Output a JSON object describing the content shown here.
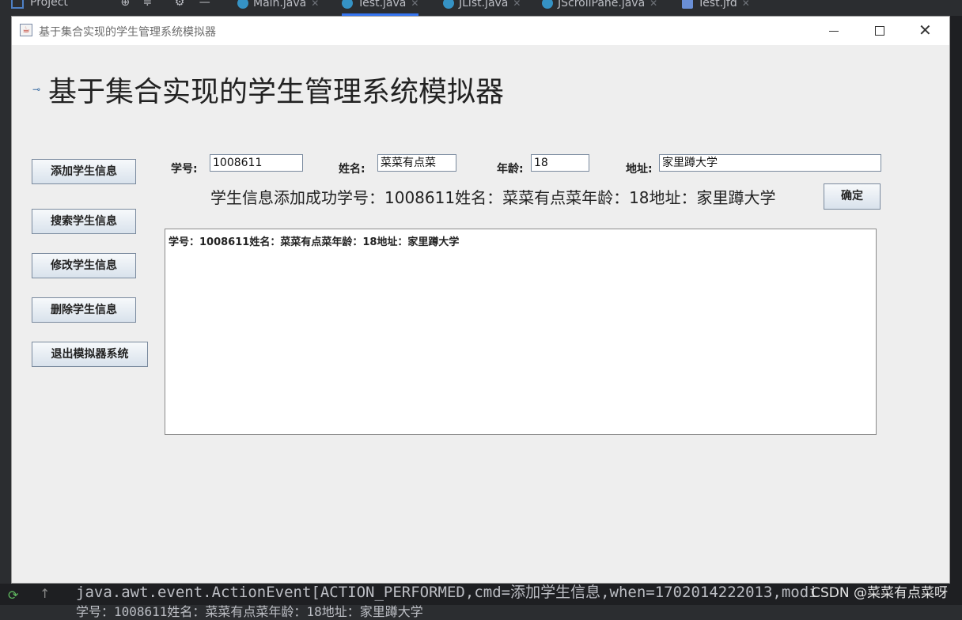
{
  "ide": {
    "project_label": "Project",
    "tabs": [
      {
        "label": "Main.java"
      },
      {
        "label": "Test.java"
      },
      {
        "label": "JList.java"
      },
      {
        "label": "JScrollPane.java"
      },
      {
        "label": "Test.jfd"
      }
    ],
    "console_line1": "java.awt.event.ActionEvent[ACTION_PERFORMED,cmd=添加学生信息,when=1702014222013,modi",
    "console_line2": "学号：1008611姓名：菜菜有点菜年龄：18地址：家里蹲大学",
    "watermark": "CSDN @菜菜有点菜呀"
  },
  "window": {
    "title": "基于集合实现的学生管理系统模拟器",
    "heading": "基于集合实现的学生管理系统模拟器"
  },
  "sidebar": {
    "buttons": [
      {
        "label": "添加学生信息"
      },
      {
        "label": "搜索学生信息"
      },
      {
        "label": "修改学生信息"
      },
      {
        "label": "删除学生信息"
      },
      {
        "label": "退出模拟器系统"
      }
    ]
  },
  "form": {
    "id_label": "学号:",
    "id_value": "1008611",
    "name_label": "姓名:",
    "name_value": "菜菜有点菜",
    "age_label": "年龄:",
    "age_value": "18",
    "address_label": "地址:",
    "address_value": "家里蹲大学",
    "status_message": "学生信息添加成功学号：1008611姓名：菜菜有点菜年龄：18地址：家里蹲大学",
    "confirm_label": "确定"
  },
  "output": {
    "text": "学号：1008611姓名：菜菜有点菜年龄：18地址：家里蹲大学"
  }
}
